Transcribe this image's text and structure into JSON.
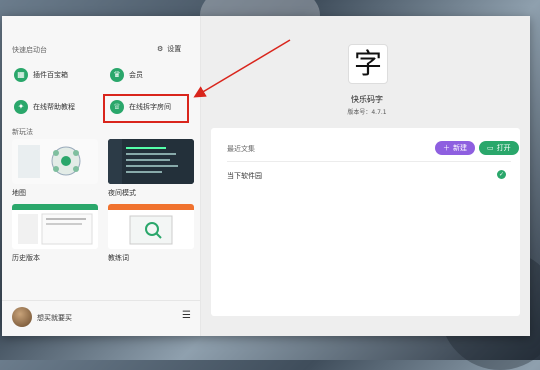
{
  "window": {
    "minimize_label": "–",
    "close_label": "✕"
  },
  "quick_launch": {
    "title": "快速启动台",
    "settings_label": "设置",
    "items": [
      {
        "label": "插件百宝箱",
        "icon": "grid-icon"
      },
      {
        "label": "会员",
        "icon": "crown-icon"
      },
      {
        "label": "在线帮助教程",
        "icon": "bulb-icon"
      },
      {
        "label": "在线拆字房间",
        "icon": "trophy-icon"
      }
    ]
  },
  "new_features": {
    "title": "新玩法",
    "items": [
      {
        "label": "地图"
      },
      {
        "label": "夜间模式"
      },
      {
        "label": "历史版本"
      },
      {
        "label": "教练词"
      }
    ]
  },
  "user": {
    "name": "想买就要买"
  },
  "app": {
    "logo_char": "字",
    "name": "快乐码字",
    "version": "版本号：4.7.1"
  },
  "recent": {
    "title": "最近文集",
    "new_label": "新建",
    "open_label": "打开",
    "files": [
      {
        "name": "当下软件园"
      }
    ]
  },
  "colors": {
    "accent_green": "#2aa76b",
    "accent_purple": "#8e5fe0",
    "highlight_red": "#d9251c"
  }
}
